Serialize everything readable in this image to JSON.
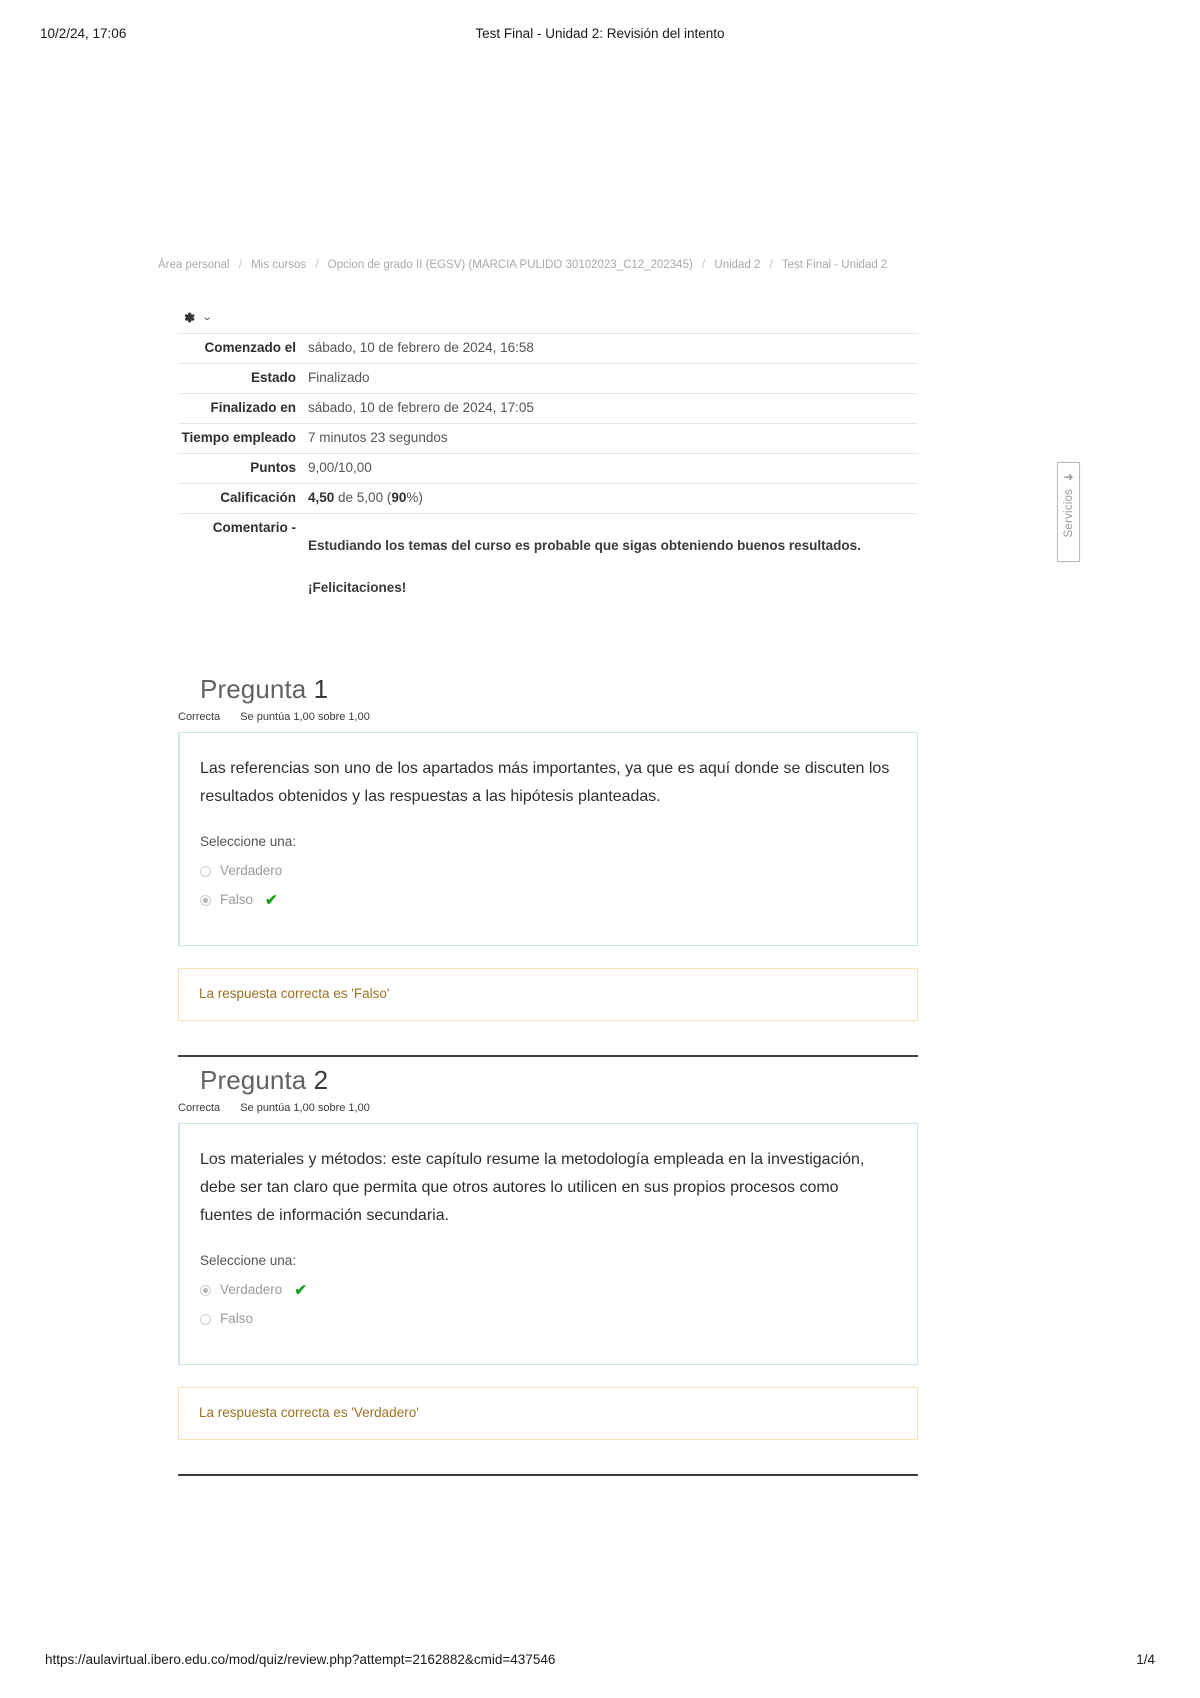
{
  "print": {
    "header_left": "10/2/24, 17:06",
    "header_center": "Test Final - Unidad 2: Revisión del intento",
    "footer_url": "https://aulavirtual.ibero.edu.co/mod/quiz/review.php?attempt=2162882&cmid=437546",
    "footer_page": "1/4"
  },
  "breadcrumb": {
    "items": [
      "Área personal",
      "Mis cursos",
      "Opcion de grado II (EGSV) (MARCIA PULIDO 30102023_C12_202345)",
      "Unidad 2",
      "Test Final - Unidad 2"
    ],
    "separator": "/"
  },
  "action_menu": {
    "gear_label": "gear",
    "chevron": "⌄"
  },
  "summary": {
    "rows": [
      {
        "label": "Comenzado el",
        "value": "sábado, 10 de febrero de 2024, 16:58"
      },
      {
        "label": "Estado",
        "value": "Finalizado"
      },
      {
        "label": "Finalizado en",
        "value": "sábado, 10 de febrero de 2024, 17:05"
      },
      {
        "label": "Tiempo empleado",
        "value": "7 minutos 23 segundos"
      },
      {
        "label": "Puntos",
        "value": "9,00/10,00"
      }
    ],
    "grade": {
      "label": "Calificación",
      "value_bold": "4,50",
      "value_mid": " de 5,00 (",
      "value_pct_bold": "90",
      "value_tail": "%)"
    },
    "comment": {
      "label": "Comentario -",
      "line1": "Estudiando  los temas del curso es probable que sigas obteniendo buenos resultados.",
      "line2": "¡Felicitaciones!"
    }
  },
  "servicios_tab": {
    "label": "Servicios",
    "arrow": "➜"
  },
  "questions": [
    {
      "title_prefix": "Pregunta",
      "number": "1",
      "state": "Correcta",
      "marks": "Se puntúa 1,00 sobre 1,00",
      "text": "Las referencias son uno de los apartados más importantes, ya que es aquí donde se discuten los resultados obtenidos y las respuestas a las hipótesis planteadas.",
      "prompt": "Seleccione una:",
      "options": [
        {
          "label": "Verdadero",
          "selected": false,
          "correct_mark": ""
        },
        {
          "label": "Falso",
          "selected": true,
          "correct_mark": "✔"
        }
      ],
      "feedback": "La respuesta correcta es 'Falso'"
    },
    {
      "title_prefix": "Pregunta",
      "number": "2",
      "state": "Correcta",
      "marks": "Se puntúa 1,00 sobre 1,00",
      "text": "Los materiales y métodos: este capítulo resume la metodología empleada en la investigación, debe ser tan claro que permita que otros autores lo utilicen en sus propios procesos como fuentes de información secundaria.",
      "prompt": "Seleccione una:",
      "options": [
        {
          "label": "Verdadero",
          "selected": true,
          "correct_mark": "✔"
        },
        {
          "label": "Falso",
          "selected": false,
          "correct_mark": ""
        }
      ],
      "feedback": "La respuesta correcta es 'Verdadero'"
    }
  ]
}
